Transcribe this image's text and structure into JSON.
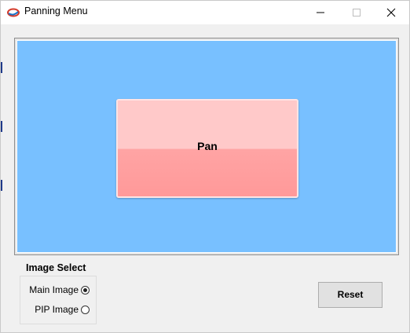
{
  "window": {
    "title": "Panning Menu",
    "app_icon": "app-logo-icon",
    "controls": {
      "minimize_icon": "minimize-icon",
      "maximize_icon": "maximize-icon",
      "close_icon": "close-icon"
    }
  },
  "pan_area": {
    "background_color": "#78c0ff",
    "button_label": "Pan",
    "button_color": "#ffa4a4"
  },
  "image_select": {
    "title": "Image Select",
    "options": [
      {
        "label": "Main Image",
        "checked": true
      },
      {
        "label": "PIP Image",
        "checked": false
      }
    ]
  },
  "reset_button": {
    "label": "Reset"
  }
}
